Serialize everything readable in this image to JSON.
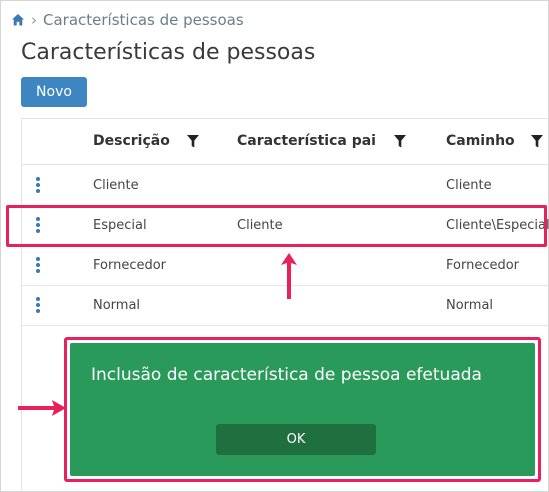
{
  "breadcrumb": {
    "home_icon": "home-icon",
    "current": "Características de pessoas"
  },
  "page": {
    "title": "Características de pessoas"
  },
  "toolbar": {
    "new_label": "Novo"
  },
  "table": {
    "columns": [
      "Descrição",
      "Característica pai",
      "Caminho"
    ],
    "rows": [
      {
        "descricao": "Cliente",
        "pai": "",
        "caminho": "Cliente"
      },
      {
        "descricao": "Especial",
        "pai": "Cliente",
        "caminho": "Cliente\\Especial"
      },
      {
        "descricao": "Fornecedor",
        "pai": "",
        "caminho": "Fornecedor"
      },
      {
        "descricao": "Normal",
        "pai": "",
        "caminho": "Normal"
      }
    ]
  },
  "dialog": {
    "message": "Inclusão de característica de pessoa efetuada",
    "ok_label": "OK"
  },
  "colors": {
    "accent": "#3d86c2",
    "dialog_bg": "#2a9a5a",
    "annotation": "#e8205c"
  }
}
